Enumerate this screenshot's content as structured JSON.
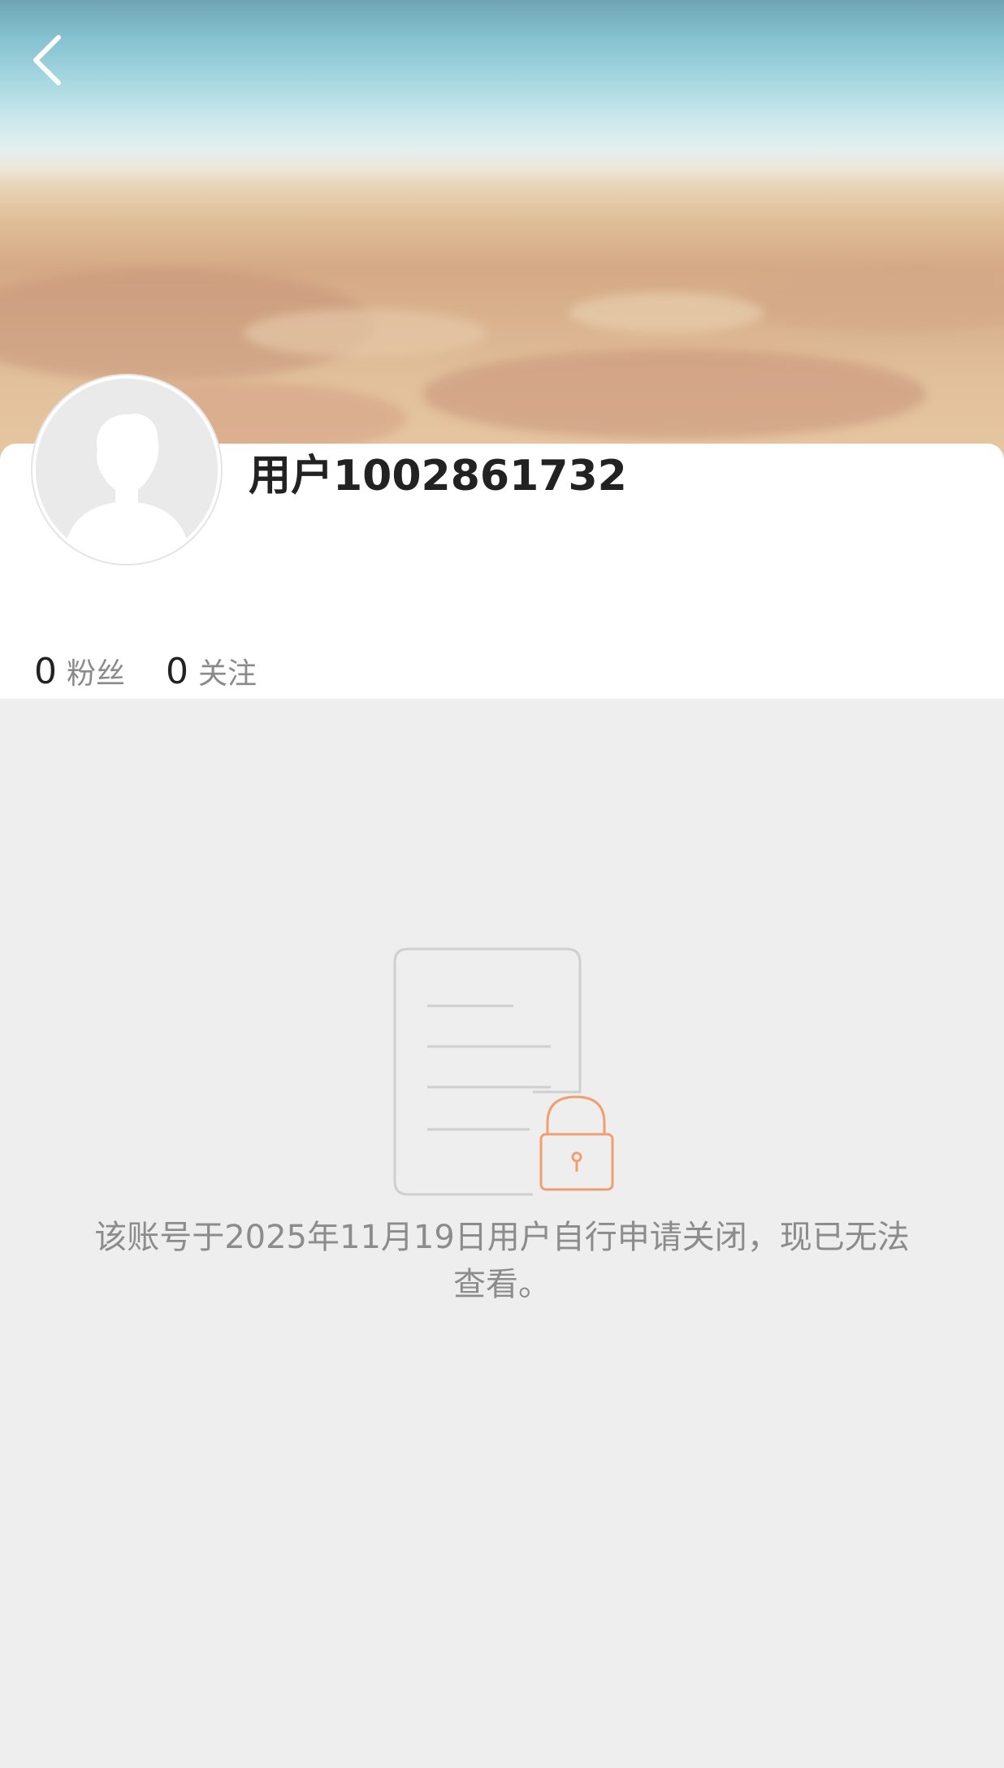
{
  "header": {
    "back_icon": "chevron-left-icon"
  },
  "profile": {
    "avatar_icon": "default-avatar-icon",
    "username": "用户1002861732",
    "followers": {
      "count": "0",
      "label": "粉丝"
    },
    "following": {
      "count": "0",
      "label": "关注"
    }
  },
  "locked_state": {
    "illustration_icon": "locked-document-icon",
    "message": "该账号于2025年11月19日用户自行申请关闭，现已无法查看。"
  },
  "colors": {
    "accent_lock": "#f0a070",
    "page_background": "#eeeeee",
    "card_background": "#ffffff",
    "secondary_text": "#8c8c8c"
  }
}
